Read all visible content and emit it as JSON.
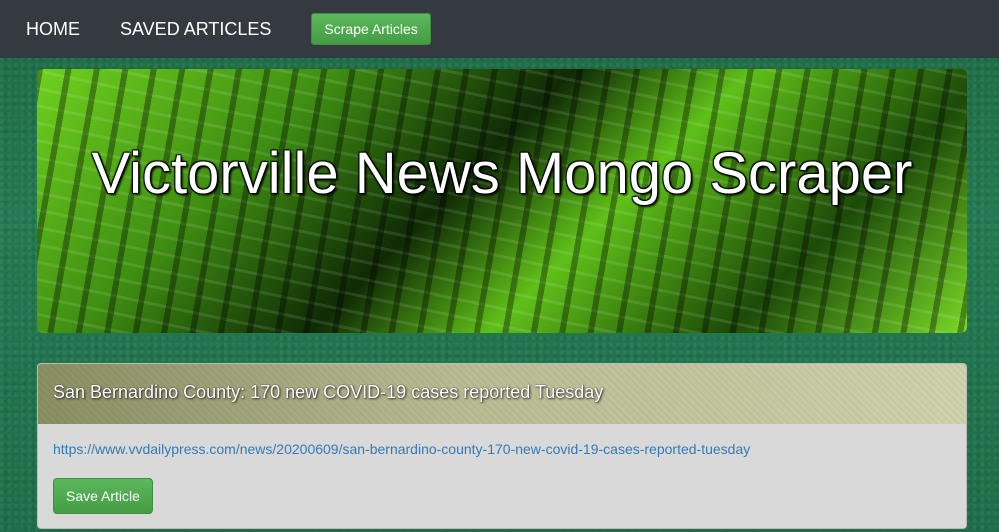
{
  "nav": {
    "home_label": "HOME",
    "saved_label": "SAVED ARTICLES",
    "scrape_label": "Scrape Articles"
  },
  "hero": {
    "title": "Victorville News Mongo Scraper"
  },
  "articles": [
    {
      "title": "San Bernardino County: 170 new COVID-19 cases reported Tuesday",
      "url": "https://www.vvdailypress.com/news/20200609/san-bernardino-county-170-new-covid-19-cases-reported-tuesday",
      "save_label": "Save Article"
    }
  ]
}
